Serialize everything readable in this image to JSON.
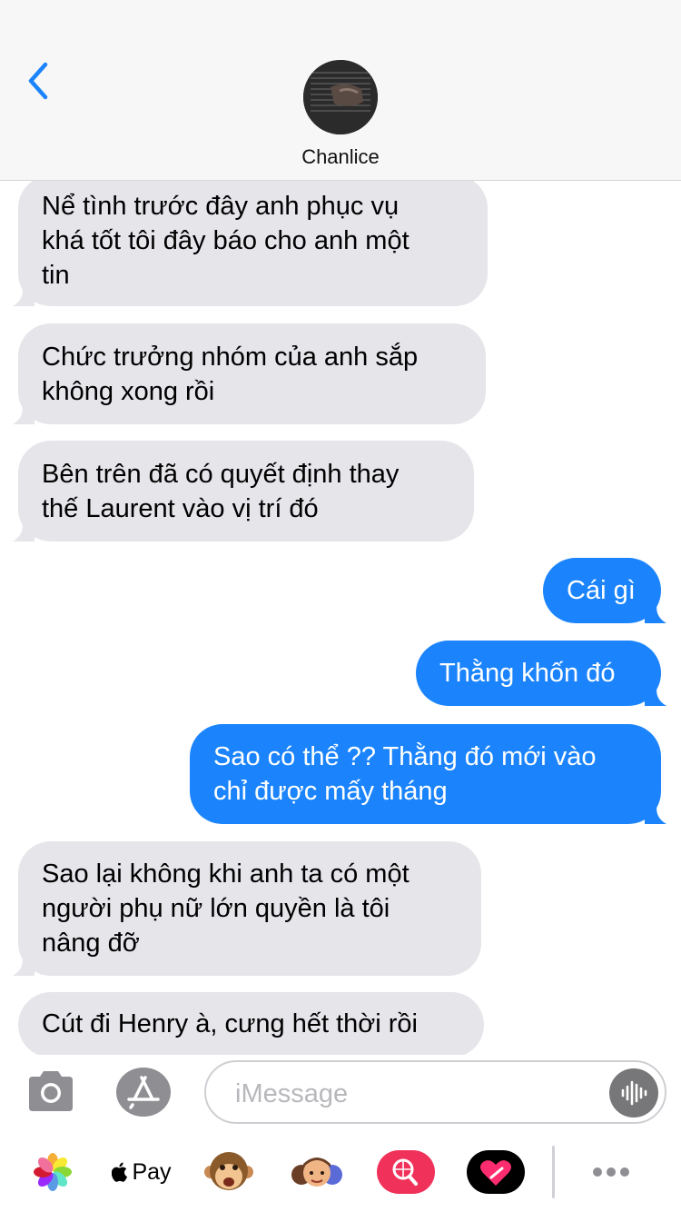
{
  "header": {
    "contact_name": "Chanlice"
  },
  "messages": [
    {
      "direction": "incoming",
      "text": "Nể tình trước đây anh phục vụ\nkhá tốt tôi đây báo cho anh một\ntin"
    },
    {
      "direction": "incoming",
      "text": "Chức trưởng nhóm của anh sắp\nkhông xong rồi"
    },
    {
      "direction": "incoming",
      "text": "Bên trên đã có quyết định thay\nthế  Laurent vào vị trí đó"
    },
    {
      "direction": "outgoing",
      "text": "Cái gì"
    },
    {
      "direction": "outgoing",
      "text": "Thằng khốn đó"
    },
    {
      "direction": "outgoing",
      "text": "Sao có thể ?? Thằng đó mới vào\nchỉ được mấy tháng"
    },
    {
      "direction": "incoming",
      "text": "Sao lại không khi anh ta có một\nngười phụ nữ lớn quyền là tôi\nnâng đỡ"
    },
    {
      "direction": "incoming",
      "text": "Cút đi Henry à, cưng hết thời rồi"
    }
  ],
  "compose": {
    "placeholder": "iMessage",
    "camera_icon": "camera-icon",
    "apps_icon": "app-store-icon",
    "audio_icon": "audio-waveform-icon"
  },
  "drawer": {
    "apple_pay_label": "Pay",
    "apps": [
      "photos-icon",
      "apple-pay-icon",
      "monkey-memoji-icon",
      "memoji-stickers-icon",
      "image-search-icon",
      "digital-touch-icon",
      "more-icon"
    ]
  },
  "colors": {
    "accent": "#1b84fc",
    "incoming_bubble": "#e5e5ea",
    "outgoing_bubble": "#1b84fc",
    "battery": "#ffcc00"
  }
}
